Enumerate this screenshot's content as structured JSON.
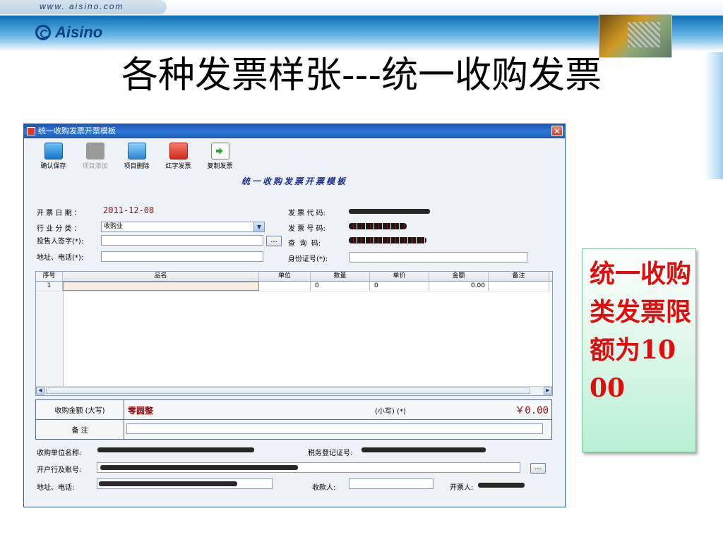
{
  "header": {
    "url": "www. aisino.com",
    "logo": "Aisino",
    "title": "各种发票样张---统一收购发票"
  },
  "window": {
    "title": "统一收购发票开票模板",
    "close": "✕",
    "toolbar": {
      "confirm_save": "确认保存",
      "add_item": "项目添加",
      "delete_item": "项目删除",
      "red_invoice": "红字发票",
      "copy_invoice": "复制发票"
    },
    "form_title": "统一收购发票开票模板",
    "fields": {
      "date_label": "开 票 日 期 ：",
      "date_value": "2011-12-08",
      "industry_label": "行 业 分 类 ：",
      "industry_value": "收购业",
      "seller_sign_label": "投售人签字(*):",
      "address_phone_label": "地址、电话(*):",
      "invoice_code_label": "发 票 代 码:",
      "invoice_number_label": "发 票 号 码:",
      "query_code_label": "查  询  码:",
      "id_number_label": "身份证号(*):",
      "ellipsis": "..."
    },
    "table": {
      "columns": [
        "序号",
        "品名",
        "单位",
        "数量",
        "单价",
        "金额",
        "备注"
      ],
      "rows": [
        {
          "index": "1",
          "name": "",
          "unit": "",
          "qty": "0",
          "price": "0",
          "amount": "0.00",
          "note": ""
        }
      ]
    },
    "totals": {
      "amount_upper_label": "收购金额 (大写)",
      "amount_upper_value": "零圆整",
      "amount_lower_label": "(小写) (*)",
      "amount_lower_value": "￥0.00",
      "remark_label": "备    注"
    },
    "footer": {
      "buyer_name_label": "收购单位名称:",
      "tax_reg_label": "税务登记证号:",
      "bank_account_label": "开户行及账号:",
      "address_phone_label": "地址、电话:",
      "payee_label": "收款人:",
      "drawer_label": "开票人:"
    }
  },
  "note": {
    "text": "统一收购类发票限额为1000",
    "color": "#e10d0d"
  }
}
